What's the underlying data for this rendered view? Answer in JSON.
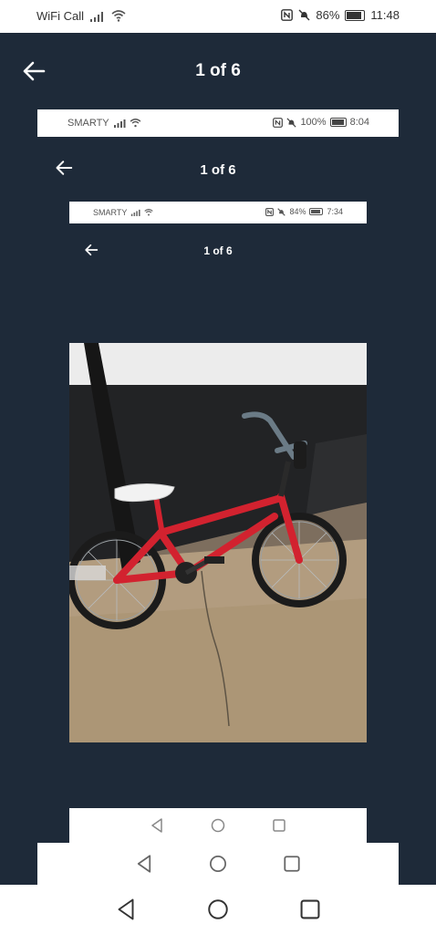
{
  "status_bar": {
    "carrier": "WiFi Call",
    "battery": "86%",
    "time": "11:48"
  },
  "viewer": {
    "counter": "1 of 6",
    "nested_1": {
      "carrier": "SMARTY",
      "battery": "100%",
      "time": "8:04",
      "counter": "1 of 6"
    },
    "nested_2": {
      "carrier": "SMARTY",
      "battery": "84%",
      "time": "7:34",
      "counter": "1 of 6"
    },
    "photo": "red-bmx-bike"
  },
  "colors": {
    "viewer_bg": "#1e2a39",
    "bike_red": "#d2222f"
  },
  "icons": [
    "back-arrow-icon",
    "signal-icon",
    "wifi-icon",
    "nfc-icon",
    "mute-icon",
    "battery-icon",
    "nav-back-icon",
    "nav-home-icon",
    "nav-recents-icon"
  ]
}
